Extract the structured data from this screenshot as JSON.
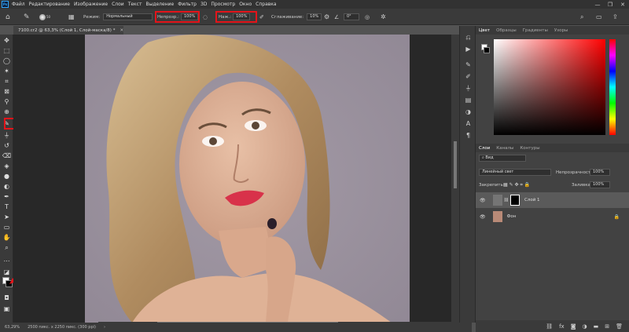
{
  "app": {
    "logo": "Ps",
    "menu": [
      "Файл",
      "Редактирование",
      "Изображение",
      "Слои",
      "Текст",
      "Выделение",
      "Фильтр",
      "3D",
      "Просмотр",
      "Окно",
      "Справка"
    ]
  },
  "options_bar": {
    "brush_size": "50",
    "mode_label": "Режим:",
    "mode_value": "Нормальный",
    "opacity_label": "Непрозр.:",
    "opacity_value": "100%",
    "flow_label": "Наж.:",
    "flow_value": "100%",
    "smoothing_label": "Сглаживание:",
    "smoothing_value": "10%",
    "angle_value": "0°"
  },
  "document": {
    "tab_title": "7100.cr2 @ 63,3% (Слой 1, Слой-маска/8) *",
    "zoom": "63,29%",
    "info": "2500 пикс. x 2250 пикс. (300 ppi)"
  },
  "color_panel": {
    "tabs": [
      "Цвет",
      "Образцы",
      "Градиенты",
      "Узоры"
    ]
  },
  "layers_panel": {
    "tabs": [
      "Слои",
      "Каналы",
      "Контуры"
    ],
    "filter_label": "Вид",
    "blend_mode": "Линейный свет",
    "opacity_label": "Непрозрачность:",
    "opacity_value": "100%",
    "lock_label": "Закрепить:",
    "fill_label": "Заливка:",
    "fill_value": "100%",
    "layers": [
      {
        "name": "Слой 1"
      },
      {
        "name": "Фон"
      }
    ]
  },
  "colors": {
    "highlight": "#e3141a",
    "accent": "#31a8ff"
  }
}
